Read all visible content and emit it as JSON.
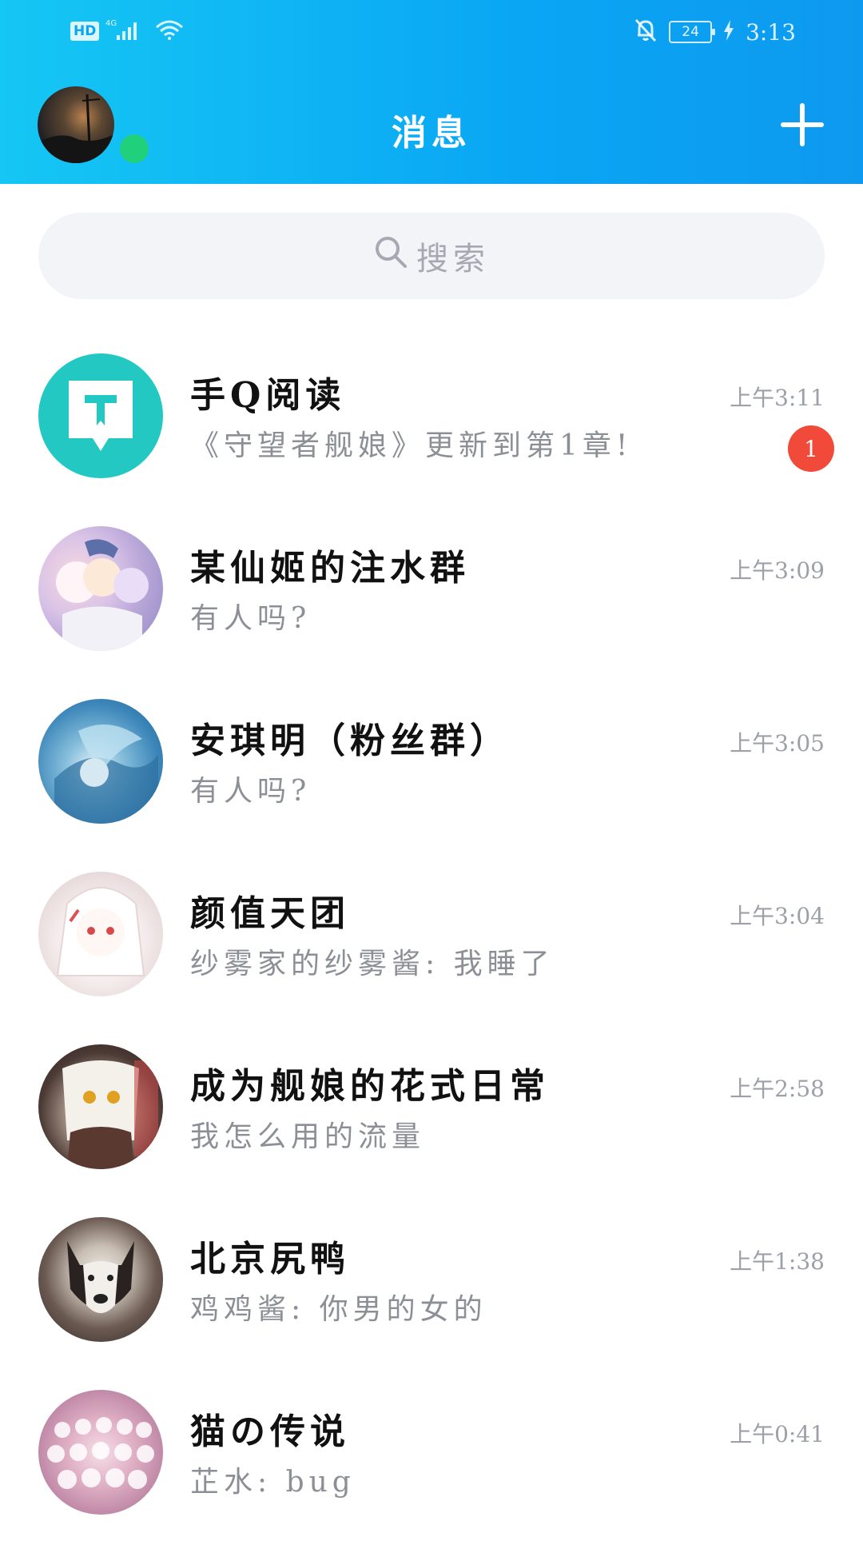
{
  "status_bar": {
    "hd": "HD",
    "network": "4G",
    "battery": "24",
    "time": "3:13"
  },
  "header": {
    "title": "消息"
  },
  "search": {
    "placeholder": "搜索"
  },
  "conversations": [
    {
      "name": "手Q阅读",
      "preview": "《守望者舰娘》更新到第1章!",
      "time": "上午3:11",
      "unread": "1"
    },
    {
      "name": "某仙姬的注水群",
      "preview": "有人吗?",
      "time": "上午3:09"
    },
    {
      "name": "安琪明（粉丝群）",
      "preview": "有人吗?",
      "time": "上午3:05"
    },
    {
      "name": "颜值天团",
      "preview": "纱雾家的纱雾酱: 我睡了",
      "time": "上午3:04"
    },
    {
      "name": "成为舰娘的花式日常",
      "preview": "我怎么用的流量",
      "time": "上午2:58"
    },
    {
      "name": "北京尻鸭",
      "preview": "鸡鸡酱: 你男的女的",
      "time": "上午1:38"
    },
    {
      "name": "猫の传说",
      "preview": "芷水: bug",
      "time": "上午0:41"
    }
  ],
  "colors": {
    "header_start": "#15c7f4",
    "header_end": "#0d99ef",
    "online": "#21d07a",
    "badge": "#f24a3a"
  }
}
